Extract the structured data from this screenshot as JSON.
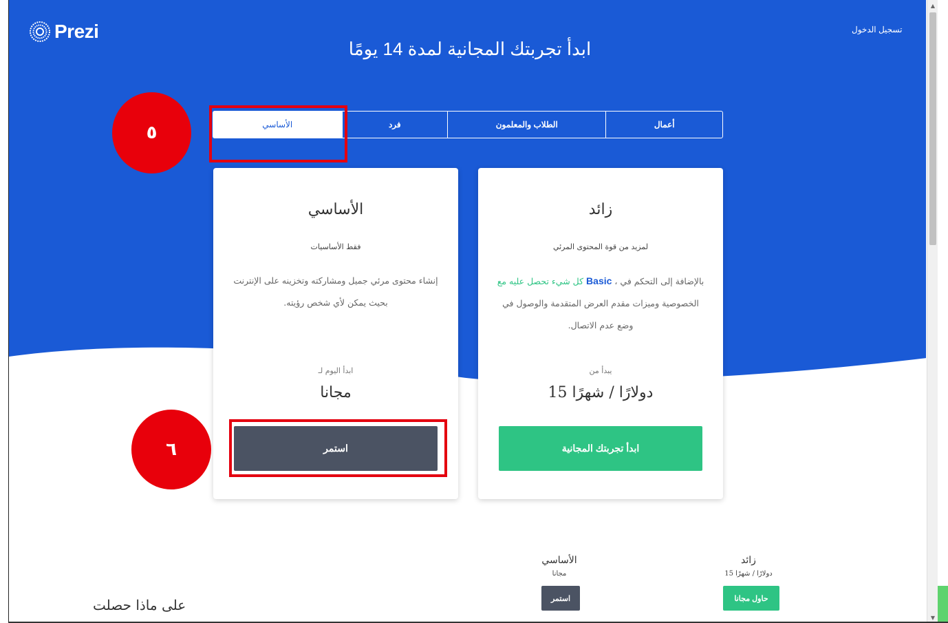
{
  "app": {
    "logo_text": "Prezi",
    "login": "تسجيل الدخول"
  },
  "hero": {
    "title": "ابدأ تجربتك المجانية لمدة 14 يومًا"
  },
  "tabs": [
    {
      "label": "أعمال"
    },
    {
      "label": "الطلاب والمعلمون"
    },
    {
      "label": "فرد"
    },
    {
      "label": "الأساسي",
      "active": true
    }
  ],
  "plus_card": {
    "title": "زائد",
    "subtitle": "لمزيد من قوة المحتوى المرئي",
    "desc_part1": "بالإضافة إلى التحكم في ،",
    "desc_basic": "Basic",
    "desc_green": "كل شيء تحصل عليه مع",
    "desc_part2": "الخصوصية وميزات مقدم العرض المتقدمة والوصول في وضع عدم الاتصال.",
    "pre_price": "يبدأ من",
    "price": "دولارًا / شهرًا 15",
    "button": "ابدأ تجربتك المجانية"
  },
  "basic_card": {
    "title": "الأساسي",
    "subtitle": "فقط الأساسيات",
    "desc": "إنشاء محتوى مرئي جميل ومشاركته وتخزينه على الإنترنت بحيث يمكن لأي شخص رؤيته.",
    "pre_price": "ابدأ اليوم لـ",
    "price": "مجانا",
    "button": "استمر"
  },
  "annotations": {
    "step5": "٥",
    "step6": "٦"
  },
  "comparison": {
    "heading": "على ماذا حصلت",
    "basic": {
      "title": "الأساسي",
      "price": "مجانا",
      "button": "استمر"
    },
    "plus": {
      "title": "زائد",
      "price": "دولارًا / شهرًا 15",
      "button": "حاول مجانا"
    }
  },
  "colors": {
    "hero_blue": "#1a5ad6",
    "green": "#2ec484",
    "dark_button": "#4b5363",
    "annotation_red": "#e4000f"
  }
}
